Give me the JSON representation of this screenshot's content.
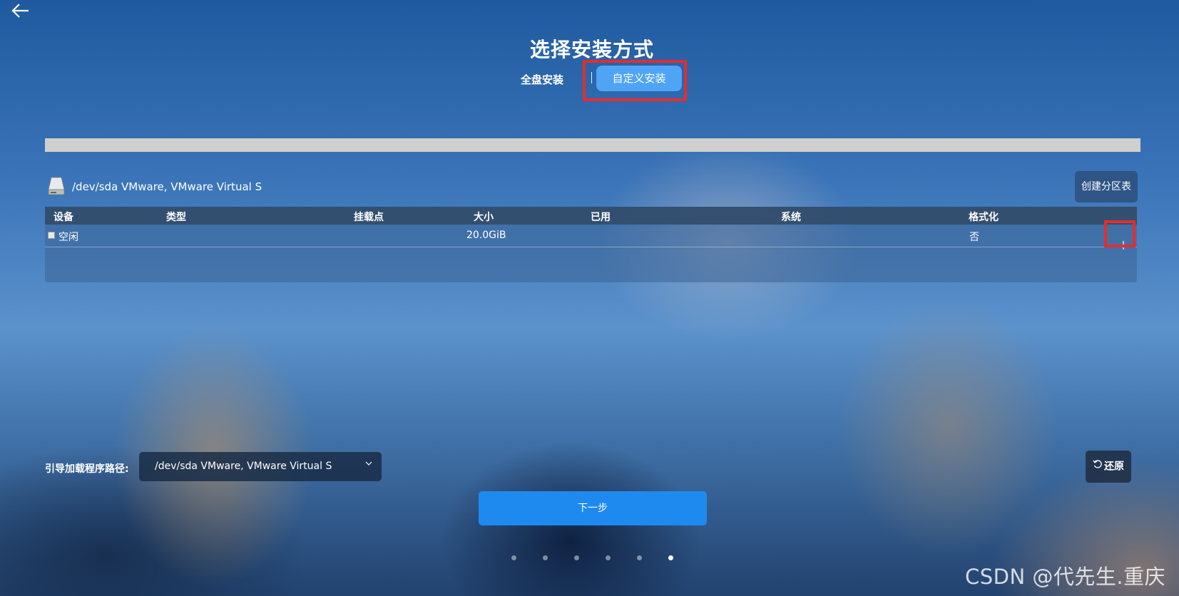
{
  "page": {
    "title": "选择安装方式"
  },
  "tabs": {
    "full_disk": "全盘安装",
    "custom": "自定义安装",
    "selected": "custom"
  },
  "disk": {
    "label": "/dev/sda VMware, VMware Virtual S",
    "create_partition_table_label": "创建分区表"
  },
  "table": {
    "headers": [
      "设备",
      "类型",
      "挂载点",
      "大小",
      "已用",
      "系统",
      "格式化"
    ],
    "rows": [
      {
        "device": "空闲",
        "type": "",
        "mount": "",
        "size": "20.0GiB",
        "used": "",
        "system": "",
        "format": "否"
      }
    ],
    "add_icon": "plus-icon"
  },
  "bootloader": {
    "label": "引导加载程序路径:",
    "selected_value": "/dev/sda VMware, VMware Virtual S"
  },
  "restore_label": "还原",
  "next_label": "下一步",
  "pagination": {
    "total": 6,
    "current": 6
  },
  "watermark": "CSDN @代先生.重庆",
  "colors": {
    "accent": "#1e8af0",
    "tab_active": "#50a4f5",
    "highlight": "#e52d2d"
  }
}
